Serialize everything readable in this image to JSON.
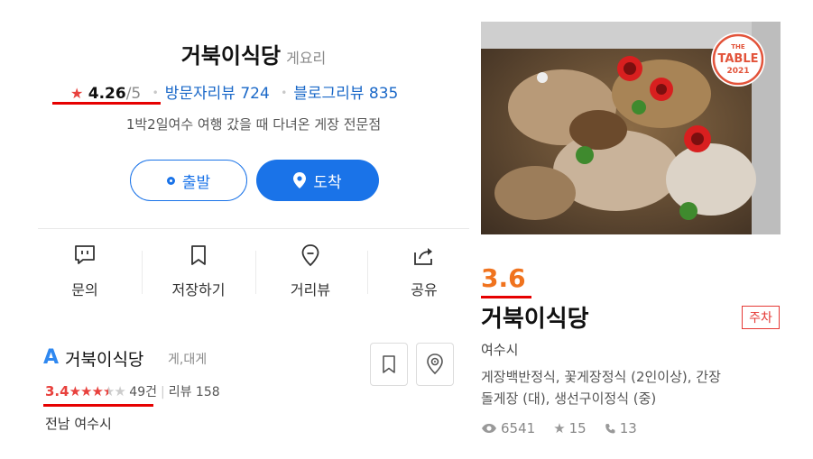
{
  "place": {
    "name": "거북이식당",
    "category": "게요리",
    "rating_star": "★",
    "rating": "4.26",
    "rating_scale": "/5",
    "visitor_reviews_label": "방문자리뷰 724",
    "blog_reviews_label": "블로그리뷰 835",
    "description": "1박2일여수 여행 갔을 때 다녀온 게장 전문점",
    "depart_label": "출발",
    "arrive_label": "도착",
    "actions": [
      {
        "icon": "message-icon",
        "label": "문의"
      },
      {
        "icon": "bookmark-icon",
        "label": "저장하기"
      },
      {
        "icon": "location-heart-icon",
        "label": "거리뷰"
      },
      {
        "icon": "share-icon",
        "label": "공유"
      }
    ]
  },
  "listing2": {
    "logo_letter": "A",
    "name": "거북이식당",
    "category": "게,대게",
    "rating": "3.4",
    "rating_value": 3.4,
    "reviews_count": "49건",
    "separator": "|",
    "reviews_label": "리뷰 158",
    "address": "전남 여수시"
  },
  "table_card": {
    "badge_top": "THE",
    "badge_main": "TABLE",
    "badge_year": "2021",
    "score": "3.6",
    "name": "거북이식당",
    "parking": "주차",
    "city": "여수시",
    "menu_line1": "게장백반정식, 꽃게장정식 (2인이상), 간장",
    "menu_line2": "돌게장 (대), 생선구이정식 (중)",
    "views": "6541",
    "stars": "15",
    "calls": "13"
  },
  "colors": {
    "accent_blue": "#1a73e8",
    "rating_red": "#e8413d",
    "score_orange": "#f0731e",
    "underline_red": "#e60000"
  }
}
